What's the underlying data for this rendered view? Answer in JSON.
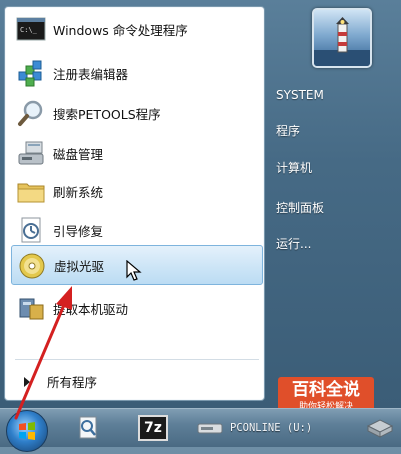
{
  "start_menu": {
    "items": [
      {
        "label": "Windows 命令处理程序",
        "icon": "command-prompt-icon"
      },
      {
        "label": "注册表编辑器",
        "icon": "registry-editor-icon"
      },
      {
        "label": "搜索PETOOLS程序",
        "icon": "magnifier-icon"
      },
      {
        "label": "磁盘管理",
        "icon": "disk-management-icon"
      },
      {
        "label": "刷新系统",
        "icon": "folder-icon"
      },
      {
        "label": "引导修复",
        "icon": "boot-repair-icon"
      },
      {
        "label": "虚拟光驱",
        "icon": "cd-drive-icon",
        "highlighted": true
      },
      {
        "label": "提取本机驱动",
        "icon": "driver-extract-icon"
      }
    ],
    "all_programs_label": "所有程序"
  },
  "right_panel": {
    "user_picture": "lighthouse-user-picture",
    "items": [
      "SYSTEM",
      "程序",
      "计算机",
      "控制面板",
      "运行..."
    ]
  },
  "taskbar": {
    "buttons": [
      {
        "icon": "start-orb-icon"
      },
      {
        "icon": "magnifier-document-icon"
      },
      {
        "icon": "7zip-icon",
        "text": "7z"
      },
      {
        "icon": "usb-drive-icon",
        "label": "PCONLINE (U:)"
      },
      {
        "icon": "network-drive-icon"
      }
    ]
  },
  "watermark": {
    "title": "百科全说",
    "subtitle": "助你轻松解决"
  },
  "annotation": {
    "arrow_color": "#d42020"
  }
}
